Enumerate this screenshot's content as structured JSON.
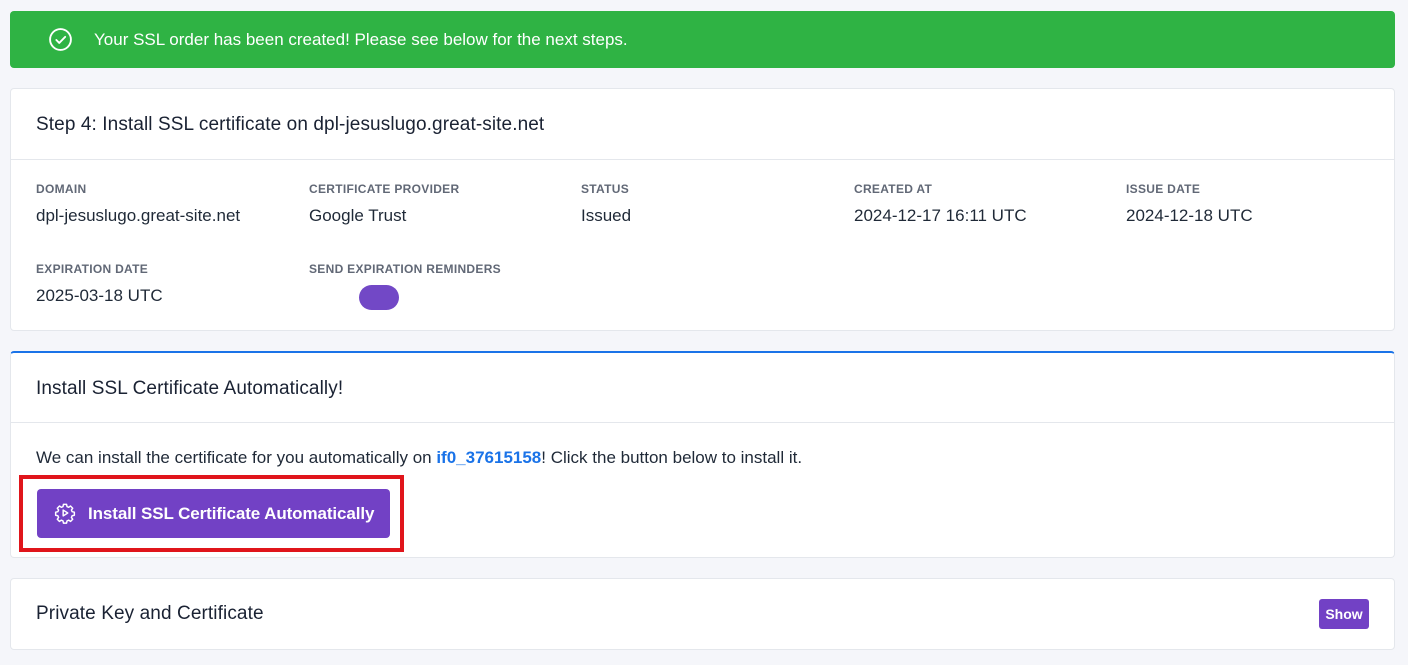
{
  "alert": {
    "message": "Your SSL order has been created! Please see below for the next steps."
  },
  "step_card": {
    "title": "Step 4: Install SSL certificate on dpl-jesuslugo.great-site.net",
    "fields": {
      "domain": {
        "label": "DOMAIN",
        "value": "dpl-jesuslugo.great-site.net"
      },
      "provider": {
        "label": "CERTIFICATE PROVIDER",
        "value": "Google Trust"
      },
      "status": {
        "label": "STATUS",
        "value": "Issued"
      },
      "created": {
        "label": "CREATED AT",
        "value": "2024-12-17 16:11 UTC"
      },
      "issue": {
        "label": "ISSUE DATE",
        "value": "2024-12-18 UTC"
      },
      "expiration": {
        "label": "EXPIRATION DATE",
        "value": "2025-03-18 UTC"
      },
      "reminders": {
        "label": "SEND EXPIRATION REMINDERS",
        "enabled": true
      }
    }
  },
  "auto_card": {
    "title": "Install SSL Certificate Automatically!",
    "desc_before": "We can install the certificate for you automatically on ",
    "server": "if0_37615158",
    "desc_after": "! Click the button below to install it.",
    "button_label": "Install SSL Certificate Automatically"
  },
  "keys_card": {
    "title": "Private Key and Certificate",
    "show_label": "Show"
  },
  "colors": {
    "success": "#2fb344",
    "primary": "#7241c5",
    "link": "#1a73e8",
    "highlight": "#e0151b"
  },
  "icons": {
    "alert": "check-circle-icon",
    "install": "gear-play-icon"
  }
}
